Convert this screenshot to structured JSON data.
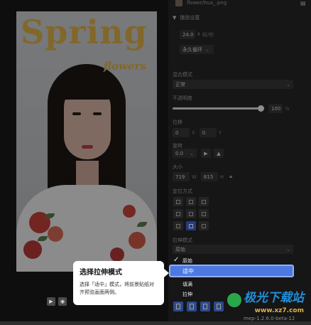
{
  "preview": {
    "headline": "Spring",
    "subheadline": "flowers"
  },
  "panel": {
    "file_name": "flower/hua_.png",
    "playback": {
      "section_title": "播放设置",
      "fps_value": "24.0",
      "fps_unit": "帧/秒",
      "loop_mode": "永久循环"
    },
    "blend": {
      "label": "混合模式",
      "value": "正常"
    },
    "opacity": {
      "label": "不透明度",
      "value": "100",
      "unit": "%",
      "level": 0.97
    },
    "position": {
      "label": "位移",
      "x_value": "0",
      "x_unit": "X",
      "y_value": "0",
      "y_unit": "Y"
    },
    "rotation": {
      "label": "旋转",
      "value": "0.0"
    },
    "size": {
      "label": "大小",
      "w_value": "719",
      "w_unit": "W",
      "h_value": "615",
      "h_unit": "H"
    },
    "anchor": {
      "label": "定位方式"
    },
    "stretch": {
      "label": "拉伸模式",
      "value": "原始",
      "options": [
        "原始",
        "适中",
        "填满",
        "拉伸"
      ],
      "selected": "适中"
    },
    "version": "mep-1.2.6.0-beta-12"
  },
  "tooltip": {
    "title": "选择拉伸模式",
    "body": "选择「适中」模式，将前景贴纸对齐预览画面两侧。"
  },
  "watermark": {
    "brand": "极光下载站",
    "url": "www.xz7.com"
  },
  "colors": {
    "accent": "#4d79e0",
    "headline": "#e0b24a",
    "panel_bg": "#242424"
  }
}
